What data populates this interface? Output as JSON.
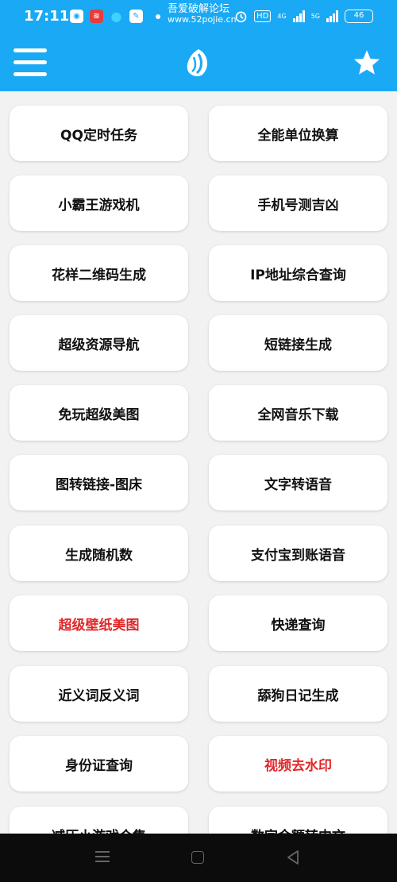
{
  "status_bar": {
    "time": "17:11",
    "notification_title": "吾爱破解论坛",
    "notification_url": "www.52pojie.cn",
    "hd_label": "HD",
    "net1_label": "4G",
    "net2_label": "5G",
    "battery": "46"
  },
  "app_bar": {
    "menu_icon": "hamburger-menu-icon",
    "logo_icon": "app-logo-icon",
    "favorite_icon": "star-icon"
  },
  "colors": {
    "accent": "#1aa9f5",
    "highlight_text": "#e0282a"
  },
  "tools": [
    {
      "label": "QQ定时任务",
      "highlight": false
    },
    {
      "label": "全能单位换算",
      "highlight": false
    },
    {
      "label": "小霸王游戏机",
      "highlight": false
    },
    {
      "label": "手机号测吉凶",
      "highlight": false
    },
    {
      "label": "花样二维码生成",
      "highlight": false
    },
    {
      "label": "IP地址综合查询",
      "highlight": false
    },
    {
      "label": "超级资源导航",
      "highlight": false
    },
    {
      "label": "短链接生成",
      "highlight": false
    },
    {
      "label": "免玩超级美图",
      "highlight": false
    },
    {
      "label": "全网音乐下载",
      "highlight": false
    },
    {
      "label": "图转链接-图床",
      "highlight": false
    },
    {
      "label": "文字转语音",
      "highlight": false
    },
    {
      "label": "生成随机数",
      "highlight": false
    },
    {
      "label": "支付宝到账语音",
      "highlight": false
    },
    {
      "label": "超级壁纸美图",
      "highlight": true
    },
    {
      "label": "快递查询",
      "highlight": false
    },
    {
      "label": "近义词反义词",
      "highlight": false
    },
    {
      "label": "舔狗日记生成",
      "highlight": false
    },
    {
      "label": "身份证查询",
      "highlight": false
    },
    {
      "label": "视频去水印",
      "highlight": true
    },
    {
      "label": "减压小游戏合集",
      "highlight": false
    },
    {
      "label": "数字金额转中文",
      "highlight": false
    }
  ]
}
